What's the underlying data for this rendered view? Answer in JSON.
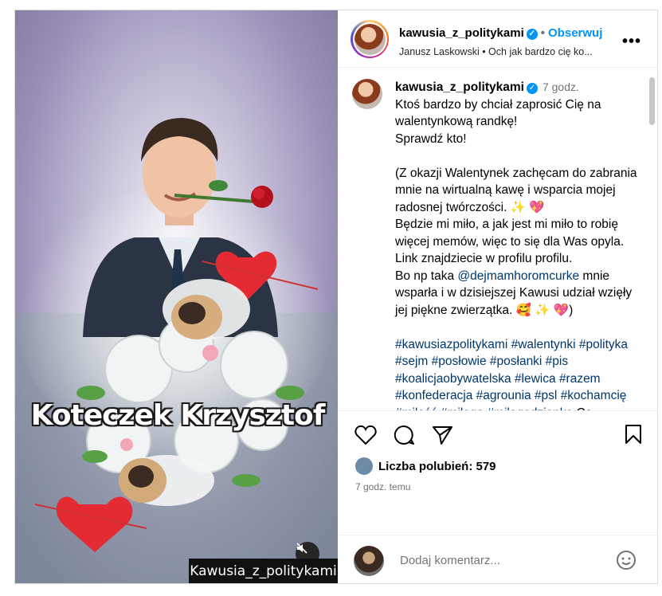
{
  "media": {
    "title": "Koteczek Krzysztof",
    "watermark": "Kawusia_z_politykami"
  },
  "header": {
    "username": "kawusia_z_politykami",
    "follow_label": "Obserwuj",
    "subline": "Janusz Laskowski • Och jak bardzo cię ko..."
  },
  "post": {
    "username": "kawusia_z_politykami",
    "time": "7 godz.",
    "text_1": "Ktoś bardzo by chciał zaprosić Cię na walentynkową randkę!\nSprawdź kto!\n\n(Z okazji Walentynek zachęcam do zabrania mnie na wirtualną kawę i wsparcia mojej radosnej twórczości. ✨ 💖\nBędzie mi miło, a jak jest mi miło to robię więcej memów, więc to się dla Was opyla. Link znajdziecie w profilu profilu.\nBo np taka ",
    "mention": "@dejmamhoromcurke",
    "text_2": " mnie wsparła i w dzisiejszej Kawusi udział wzięły jej piękne zwierzątka. 🥰 ✨ 💖)\n\n",
    "hashtags": "#kawusiazpolitykami #walentynki #polityka #sejm #posłowie #posłanki #pis #koalicjaobywatelska #lewica #razem #konfederacja #agrounia #psl #kochamcię #miłość #miłego #miłegodzionka",
    "text_3": " Co"
  },
  "likes": {
    "label": "Liczba polubień: 579",
    "ago": "7 godz. temu"
  },
  "comment": {
    "placeholder": "Dodaj komentarz..."
  }
}
